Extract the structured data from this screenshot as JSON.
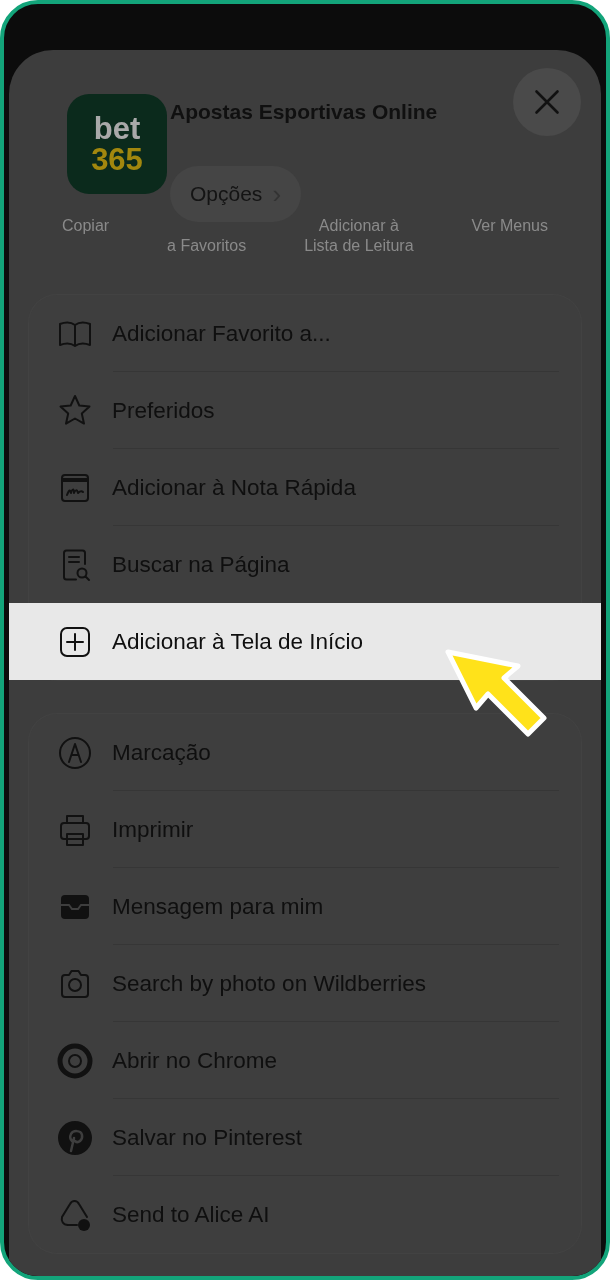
{
  "header": {
    "app_logo": {
      "line_1": "bet",
      "line_2": "365"
    },
    "title": "Apostas Esportivas Online",
    "options_button": {
      "label": "Opções",
      "chevron": "›"
    }
  },
  "faded_actions": [
    {
      "lines": [
        "Copiar"
      ]
    },
    {
      "lines": [
        "a Favoritos"
      ]
    },
    {
      "lines": [
        "Adicionar à",
        "Lista de Leitura"
      ]
    },
    {
      "lines": [
        "Ver Menus"
      ]
    }
  ],
  "menu_groups": [
    {
      "items": [
        {
          "label": "Adicionar Favorito a...",
          "selected": false
        },
        {
          "label": "Preferidos",
          "selected": false
        },
        {
          "label": "Adicionar à Nota Rápida",
          "selected": false
        },
        {
          "label": "Buscar na Página",
          "selected": false
        },
        {
          "label": "Adicionar à Tela de Início",
          "selected": true
        }
      ]
    },
    {
      "items": [
        {
          "label": "Marcação",
          "selected": false
        },
        {
          "label": "Imprimir",
          "selected": false
        },
        {
          "label": "Mensagem para mim",
          "selected": false
        },
        {
          "label": "Search by photo on Wildberries",
          "selected": false
        },
        {
          "label": "Abrir no Chrome",
          "selected": false
        },
        {
          "label": "Salvar no Pinterest",
          "selected": false
        },
        {
          "label": "Send to Alice AI",
          "selected": false
        }
      ]
    }
  ]
}
